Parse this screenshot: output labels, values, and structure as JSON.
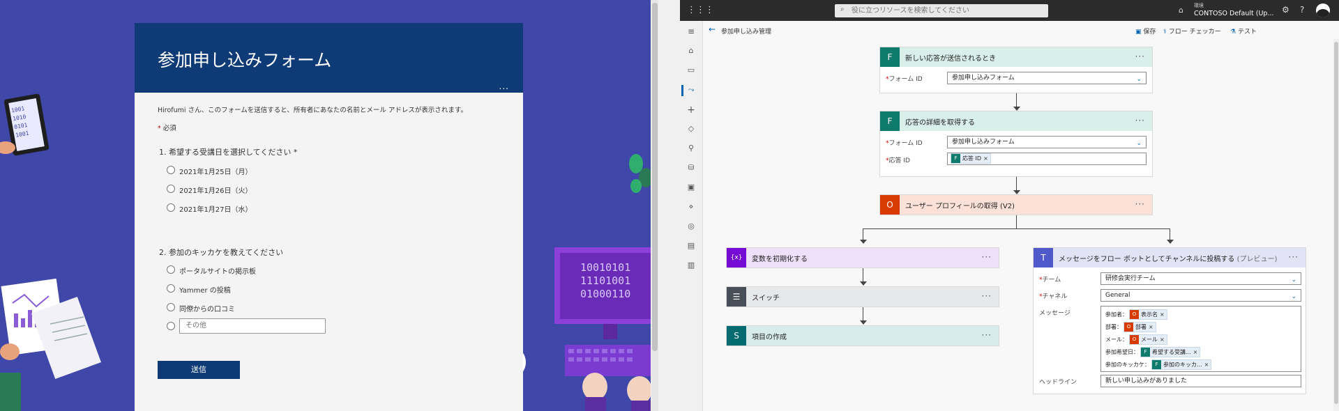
{
  "form": {
    "title": "参加申し込みフォーム",
    "more": "...",
    "notice": "Hirofumi さん、このフォームを送信すると、所有者にあなたの名前とメール アドレスが表示されます。",
    "required_star": "*",
    "required_label": "必須",
    "q1": {
      "title": "1. 希望する受講日を選択してください *",
      "options": [
        "2021年1月25日（月）",
        "2021年1月26日（火）",
        "2021年1月27日（水）"
      ]
    },
    "q2": {
      "title": "2. 参加のキッカケを教えてください",
      "options": [
        "ポータルサイトの掲示板",
        "Yammer の投稿",
        "同僚からの口コミ"
      ],
      "other_placeholder": "その他"
    },
    "submit_label": "送信",
    "binary_art": "10010101\n11101001\n01000110"
  },
  "flow": {
    "topbar": {
      "search_placeholder": "役に立つリソースを検索してください",
      "env_label": "環境",
      "env_name": "CONTOSO Default (Up...",
      "help": "?",
      "settings": "⚙"
    },
    "breadcrumb": "参加申し込み管理",
    "commands": {
      "save": "保存",
      "checker": "フロー チェッカー",
      "test": "テスト"
    },
    "trigger": {
      "title": "新しい応答が送信されるとき",
      "form_id_label": "フォーム ID",
      "form_id_value": "参加申し込みフォーム"
    },
    "details": {
      "title": "応答の詳細を取得する",
      "form_id_label": "フォーム ID",
      "form_id_value": "参加申し込みフォーム",
      "response_id_label": "応答 ID",
      "response_id_token": "応答 ID"
    },
    "profile": {
      "title": "ユーザー プロフィールの取得 (V2)"
    },
    "variable": {
      "title": "変数を初期化する",
      "icon": "{x}"
    },
    "switch": {
      "title": "スイッチ"
    },
    "create_item": {
      "title": "項目の作成"
    },
    "teams": {
      "title": "メッセージをフロー ボットとしてチャンネルに投稿する",
      "preview": "(プレビュー)",
      "team_label": "チーム",
      "team_value": "研修会実行チーム",
      "channel_label": "チャネル",
      "channel_value": "General",
      "message_label": "メッセージ",
      "msg": {
        "l1": "参加者：",
        "t1": "表示名",
        "l2": "部署：",
        "t2": "部署",
        "l3": "メール：",
        "t3": "メール",
        "l4": "参加希望日：",
        "t4": "希望する受講...",
        "l5": "参加のキッカケ：",
        "t5": "参加のキッカ..."
      },
      "headline_label": "ヘッドライン",
      "headline_value": "新しい申し込みがありました"
    },
    "dots": "···",
    "token_x": "×"
  },
  "colors": {
    "forms_bg": "#3f47a8",
    "forms_header": "#0e3a76",
    "forms_green": "#0f7b6c",
    "office_red": "#d83b01",
    "teams_purple": "#5059c9",
    "variable_purple": "#770bd6",
    "switch_gray": "#484f58",
    "sharepoint_teal": "#036c70"
  }
}
